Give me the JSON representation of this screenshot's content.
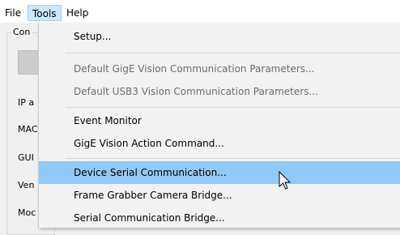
{
  "menubar": {
    "file": "File",
    "tools": "Tools",
    "help": "Help"
  },
  "background": {
    "group_title": "Con",
    "labels": [
      "IP a",
      "MAC",
      "GUI",
      "Ven",
      "Moc"
    ]
  },
  "tools_menu": {
    "items": [
      {
        "label": "Setup...",
        "enabled": true
      },
      {
        "label": "Default GigE Vision Communication Parameters...",
        "enabled": false
      },
      {
        "label": "Default USB3 Vision Communication Parameters...",
        "enabled": false
      },
      {
        "label": "Event Monitor",
        "enabled": true
      },
      {
        "label": "GigE Vision Action Command...",
        "enabled": true
      },
      {
        "label": "Device Serial Communication...",
        "enabled": true,
        "highlighted": true
      },
      {
        "label": "Frame Grabber Camera Bridge...",
        "enabled": true
      },
      {
        "label": "Serial Communication Bridge...",
        "enabled": true
      }
    ]
  },
  "colors": {
    "highlight": "#91c9f7",
    "menubar_active": "#cce8ff",
    "disabled_text": "#6d6d6d"
  }
}
